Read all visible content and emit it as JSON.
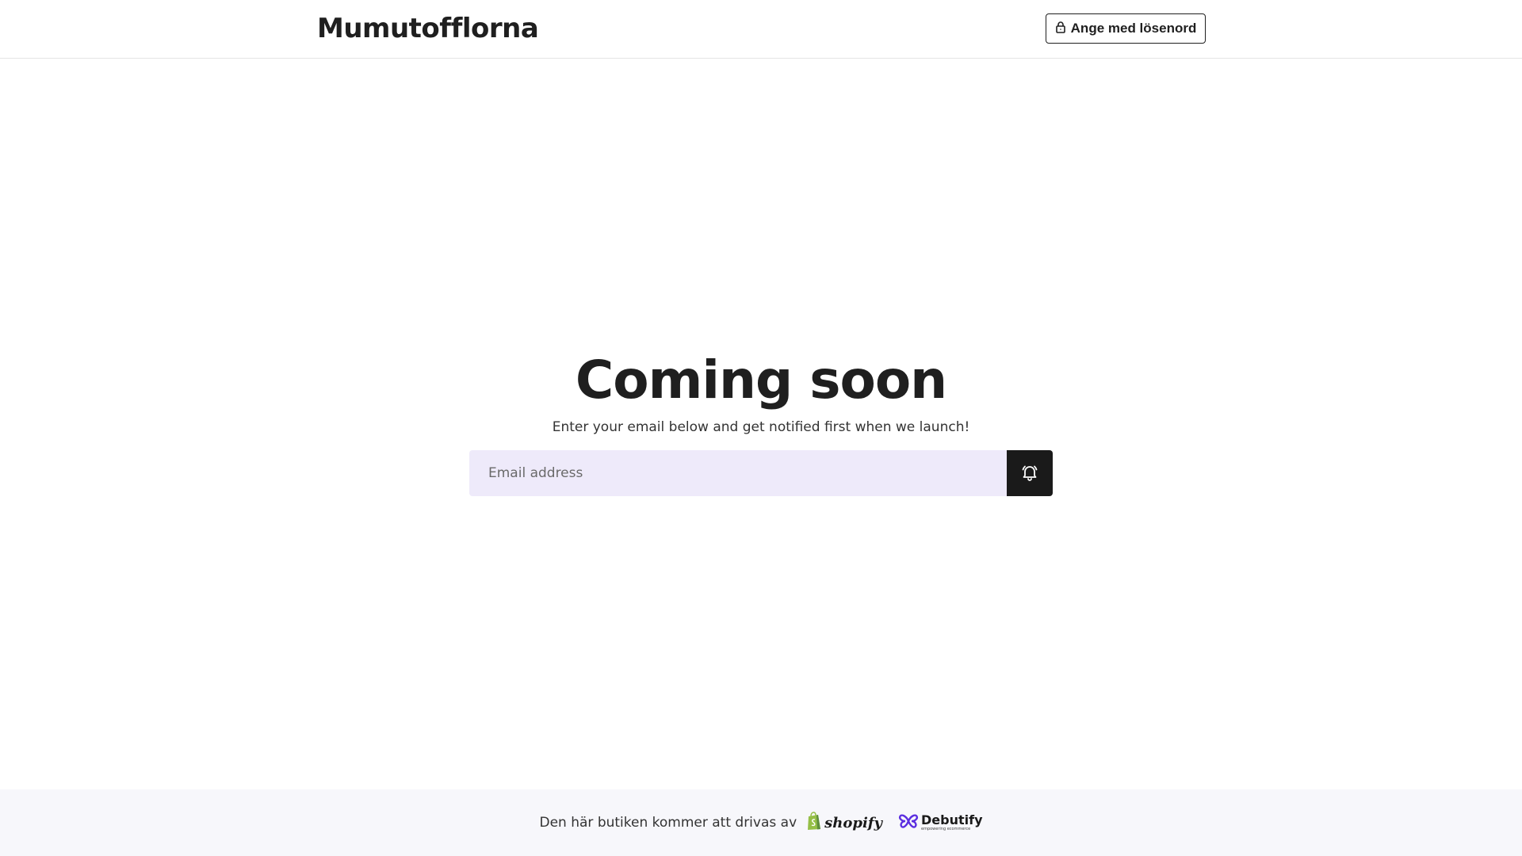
{
  "header": {
    "brand": "Mumutofflorna",
    "password_button_label": "Ange med lösenord"
  },
  "hero": {
    "title": "Coming soon",
    "subtitle": "Enter your email below and get notified first when we launch!",
    "email_placeholder": "Email address",
    "email_value": ""
  },
  "footer": {
    "powered_by_text": "Den här butiken kommer att drivas av",
    "shopify_label": "shopify",
    "debutify_label": "Debutify",
    "debutify_tagline": "empowering ecommerce"
  },
  "icons": {
    "lock": "lock-icon",
    "bell": "bell-icon",
    "shopify_bag": "shopify-bag-icon",
    "debutify_mark": "debutify-butterfly-icon"
  },
  "colors": {
    "text": "#1f1f1f",
    "input_bg": "#eeeafa",
    "button_bg": "#1a1a1a",
    "footer_bg": "#f7f7fb",
    "shopify_green": "#95bf47",
    "debutify_purple": "#5b2ee0"
  }
}
